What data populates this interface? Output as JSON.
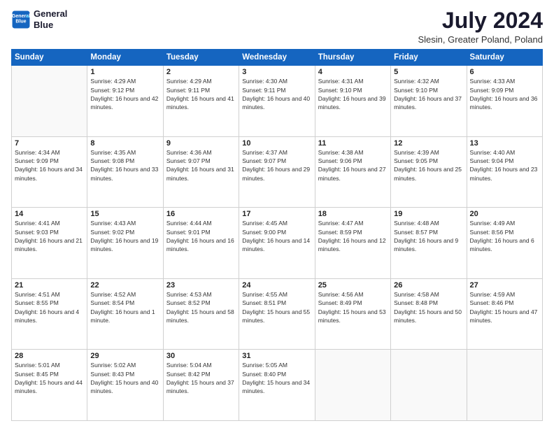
{
  "logo": {
    "line1": "General",
    "line2": "Blue"
  },
  "title": "July 2024",
  "location": "Slesin, Greater Poland, Poland",
  "weekdays": [
    "Sunday",
    "Monday",
    "Tuesday",
    "Wednesday",
    "Thursday",
    "Friday",
    "Saturday"
  ],
  "weeks": [
    [
      {
        "day": "",
        "sunrise": "",
        "sunset": "",
        "daylight": ""
      },
      {
        "day": "1",
        "sunrise": "Sunrise: 4:29 AM",
        "sunset": "Sunset: 9:12 PM",
        "daylight": "Daylight: 16 hours and 42 minutes."
      },
      {
        "day": "2",
        "sunrise": "Sunrise: 4:29 AM",
        "sunset": "Sunset: 9:11 PM",
        "daylight": "Daylight: 16 hours and 41 minutes."
      },
      {
        "day": "3",
        "sunrise": "Sunrise: 4:30 AM",
        "sunset": "Sunset: 9:11 PM",
        "daylight": "Daylight: 16 hours and 40 minutes."
      },
      {
        "day": "4",
        "sunrise": "Sunrise: 4:31 AM",
        "sunset": "Sunset: 9:10 PM",
        "daylight": "Daylight: 16 hours and 39 minutes."
      },
      {
        "day": "5",
        "sunrise": "Sunrise: 4:32 AM",
        "sunset": "Sunset: 9:10 PM",
        "daylight": "Daylight: 16 hours and 37 minutes."
      },
      {
        "day": "6",
        "sunrise": "Sunrise: 4:33 AM",
        "sunset": "Sunset: 9:09 PM",
        "daylight": "Daylight: 16 hours and 36 minutes."
      }
    ],
    [
      {
        "day": "7",
        "sunrise": "Sunrise: 4:34 AM",
        "sunset": "Sunset: 9:09 PM",
        "daylight": "Daylight: 16 hours and 34 minutes."
      },
      {
        "day": "8",
        "sunrise": "Sunrise: 4:35 AM",
        "sunset": "Sunset: 9:08 PM",
        "daylight": "Daylight: 16 hours and 33 minutes."
      },
      {
        "day": "9",
        "sunrise": "Sunrise: 4:36 AM",
        "sunset": "Sunset: 9:07 PM",
        "daylight": "Daylight: 16 hours and 31 minutes."
      },
      {
        "day": "10",
        "sunrise": "Sunrise: 4:37 AM",
        "sunset": "Sunset: 9:07 PM",
        "daylight": "Daylight: 16 hours and 29 minutes."
      },
      {
        "day": "11",
        "sunrise": "Sunrise: 4:38 AM",
        "sunset": "Sunset: 9:06 PM",
        "daylight": "Daylight: 16 hours and 27 minutes."
      },
      {
        "day": "12",
        "sunrise": "Sunrise: 4:39 AM",
        "sunset": "Sunset: 9:05 PM",
        "daylight": "Daylight: 16 hours and 25 minutes."
      },
      {
        "day": "13",
        "sunrise": "Sunrise: 4:40 AM",
        "sunset": "Sunset: 9:04 PM",
        "daylight": "Daylight: 16 hours and 23 minutes."
      }
    ],
    [
      {
        "day": "14",
        "sunrise": "Sunrise: 4:41 AM",
        "sunset": "Sunset: 9:03 PM",
        "daylight": "Daylight: 16 hours and 21 minutes."
      },
      {
        "day": "15",
        "sunrise": "Sunrise: 4:43 AM",
        "sunset": "Sunset: 9:02 PM",
        "daylight": "Daylight: 16 hours and 19 minutes."
      },
      {
        "day": "16",
        "sunrise": "Sunrise: 4:44 AM",
        "sunset": "Sunset: 9:01 PM",
        "daylight": "Daylight: 16 hours and 16 minutes."
      },
      {
        "day": "17",
        "sunrise": "Sunrise: 4:45 AM",
        "sunset": "Sunset: 9:00 PM",
        "daylight": "Daylight: 16 hours and 14 minutes."
      },
      {
        "day": "18",
        "sunrise": "Sunrise: 4:47 AM",
        "sunset": "Sunset: 8:59 PM",
        "daylight": "Daylight: 16 hours and 12 minutes."
      },
      {
        "day": "19",
        "sunrise": "Sunrise: 4:48 AM",
        "sunset": "Sunset: 8:57 PM",
        "daylight": "Daylight: 16 hours and 9 minutes."
      },
      {
        "day": "20",
        "sunrise": "Sunrise: 4:49 AM",
        "sunset": "Sunset: 8:56 PM",
        "daylight": "Daylight: 16 hours and 6 minutes."
      }
    ],
    [
      {
        "day": "21",
        "sunrise": "Sunrise: 4:51 AM",
        "sunset": "Sunset: 8:55 PM",
        "daylight": "Daylight: 16 hours and 4 minutes."
      },
      {
        "day": "22",
        "sunrise": "Sunrise: 4:52 AM",
        "sunset": "Sunset: 8:54 PM",
        "daylight": "Daylight: 16 hours and 1 minute."
      },
      {
        "day": "23",
        "sunrise": "Sunrise: 4:53 AM",
        "sunset": "Sunset: 8:52 PM",
        "daylight": "Daylight: 15 hours and 58 minutes."
      },
      {
        "day": "24",
        "sunrise": "Sunrise: 4:55 AM",
        "sunset": "Sunset: 8:51 PM",
        "daylight": "Daylight: 15 hours and 55 minutes."
      },
      {
        "day": "25",
        "sunrise": "Sunrise: 4:56 AM",
        "sunset": "Sunset: 8:49 PM",
        "daylight": "Daylight: 15 hours and 53 minutes."
      },
      {
        "day": "26",
        "sunrise": "Sunrise: 4:58 AM",
        "sunset": "Sunset: 8:48 PM",
        "daylight": "Daylight: 15 hours and 50 minutes."
      },
      {
        "day": "27",
        "sunrise": "Sunrise: 4:59 AM",
        "sunset": "Sunset: 8:46 PM",
        "daylight": "Daylight: 15 hours and 47 minutes."
      }
    ],
    [
      {
        "day": "28",
        "sunrise": "Sunrise: 5:01 AM",
        "sunset": "Sunset: 8:45 PM",
        "daylight": "Daylight: 15 hours and 44 minutes."
      },
      {
        "day": "29",
        "sunrise": "Sunrise: 5:02 AM",
        "sunset": "Sunset: 8:43 PM",
        "daylight": "Daylight: 15 hours and 40 minutes."
      },
      {
        "day": "30",
        "sunrise": "Sunrise: 5:04 AM",
        "sunset": "Sunset: 8:42 PM",
        "daylight": "Daylight: 15 hours and 37 minutes."
      },
      {
        "day": "31",
        "sunrise": "Sunrise: 5:05 AM",
        "sunset": "Sunset: 8:40 PM",
        "daylight": "Daylight: 15 hours and 34 minutes."
      },
      {
        "day": "",
        "sunrise": "",
        "sunset": "",
        "daylight": ""
      },
      {
        "day": "",
        "sunrise": "",
        "sunset": "",
        "daylight": ""
      },
      {
        "day": "",
        "sunrise": "",
        "sunset": "",
        "daylight": ""
      }
    ]
  ]
}
